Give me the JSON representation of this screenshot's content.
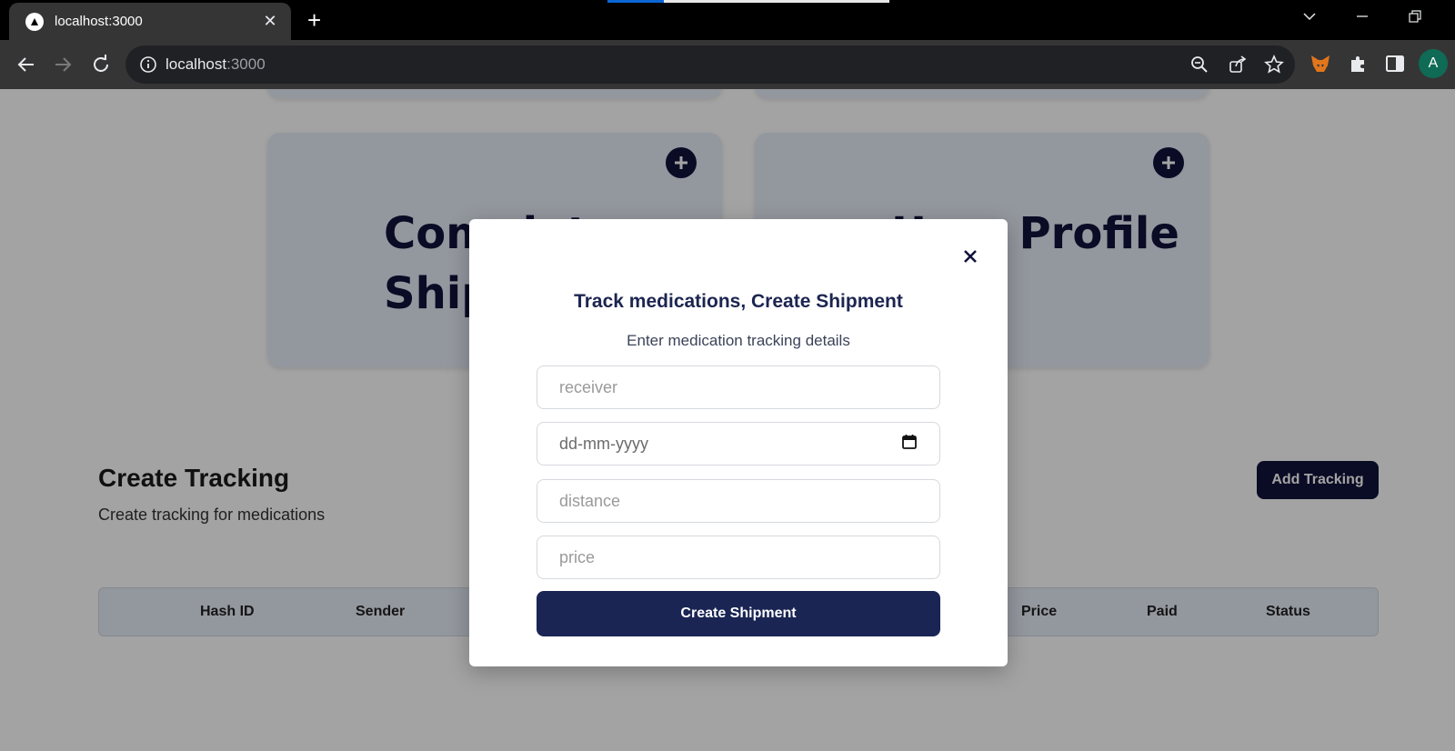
{
  "browser": {
    "tab_title": "localhost:3000",
    "url_host": "localhost",
    "url_port": ":3000",
    "profile_initial": "A"
  },
  "page": {
    "card1_heading": "Complete Shipment",
    "card2_heading": "User Profile",
    "section_title": "Create Tracking",
    "section_subtitle": "Create tracking for medications",
    "add_tracking_label": "Add Tracking",
    "table_headers": [
      "Hash ID",
      "Sender",
      "Price",
      "Paid",
      "Status"
    ]
  },
  "modal": {
    "title": "Track medications, Create Shipment",
    "subtitle": "Enter medication tracking details",
    "receiver_placeholder": "receiver",
    "date_placeholder": "dd-mm-yyyy",
    "distance_placeholder": "distance",
    "price_placeholder": "price",
    "submit_label": "Create Shipment"
  },
  "colors": {
    "accent_dark": "#10123a",
    "button_navy": "#1a2554",
    "card_bg": "#e7edf7"
  }
}
